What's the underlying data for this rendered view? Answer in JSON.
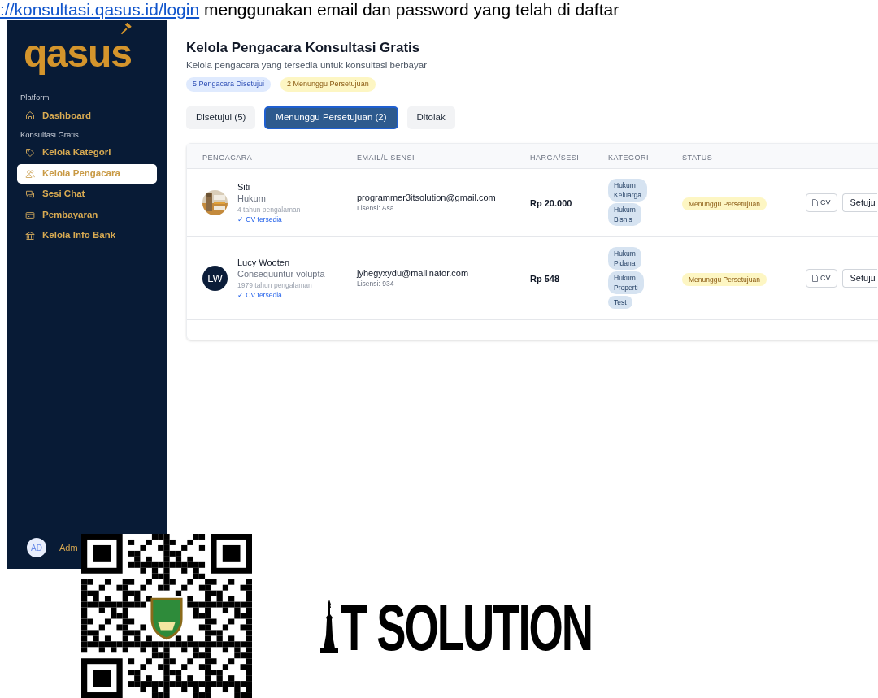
{
  "doc_line": {
    "link": "://konsultasi.qasus.id/login",
    "text": "menggunakan email dan password yang telah di daftar"
  },
  "sidebar": {
    "logo": "qasus",
    "sections": [
      {
        "label": "Platform",
        "items": [
          {
            "label": "Dashboard",
            "selected": false
          }
        ]
      },
      {
        "label": "Konsultasi Gratis",
        "items": [
          {
            "label": "Kelola Kategori",
            "selected": false
          },
          {
            "label": "Kelola Pengacara",
            "selected": true
          },
          {
            "label": "Sesi Chat",
            "selected": false
          },
          {
            "label": "Pembayaran",
            "selected": false
          },
          {
            "label": "Kelola Info Bank",
            "selected": false
          }
        ]
      }
    ],
    "user": {
      "initials": "AD",
      "name": "Adm"
    }
  },
  "header": {
    "title": "Kelola Pengacara Konsultasi Gratis",
    "subtitle": "Kelola pengacara yang tersedia untuk konsultasi berbayar",
    "badges": [
      {
        "label": "5 Pengacara Disetujui",
        "kind": "info"
      },
      {
        "label": "2 Menunggu Persetujuan",
        "kind": "warning"
      }
    ]
  },
  "tabs": [
    {
      "label": "Disetujui (5)",
      "selected": false
    },
    {
      "label": "Menunggu Persetujuan (2)",
      "selected": true
    },
    {
      "label": "Ditolak",
      "selected": false
    }
  ],
  "table": {
    "columns": [
      "PENGACARA",
      "EMAIL/LISENSI",
      "HARGA/SESI",
      "KATEGORI",
      "STATUS"
    ],
    "rows": [
      {
        "avatar": {
          "kind": "picture"
        },
        "name": "Siti",
        "specialty": "Hukum",
        "experience": "4 tahun pengalaman",
        "cv": "✓ CV tersedia",
        "email": "programmer3itsolution@gmail.com",
        "license": "Lisensi: Asa",
        "price": "Rp 20.000",
        "categories": [
          "Hukum Keluarga",
          "Hukum Bisnis"
        ],
        "status": "Menunggu Persetujuan",
        "actions": [
          "CV",
          "Setuju"
        ]
      },
      {
        "avatar": {
          "kind": "initials",
          "text": "LW"
        },
        "name": "Lucy Wooten",
        "specialty": "Consequuntur volupta",
        "experience": "1979 tahun pengalaman",
        "cv": "✓ CV tersedia",
        "email": "jyhegyxydu@mailinator.com",
        "license": "Lisensi: 934",
        "price": "Rp 548",
        "categories": [
          "Hukum Pidana",
          "Hukum Properti",
          "Test"
        ],
        "status": "Menunggu Persetujuan",
        "actions": [
          "CV",
          "Setuju"
        ]
      }
    ]
  },
  "footer_logo": {
    "text": "T SOLUTION"
  }
}
